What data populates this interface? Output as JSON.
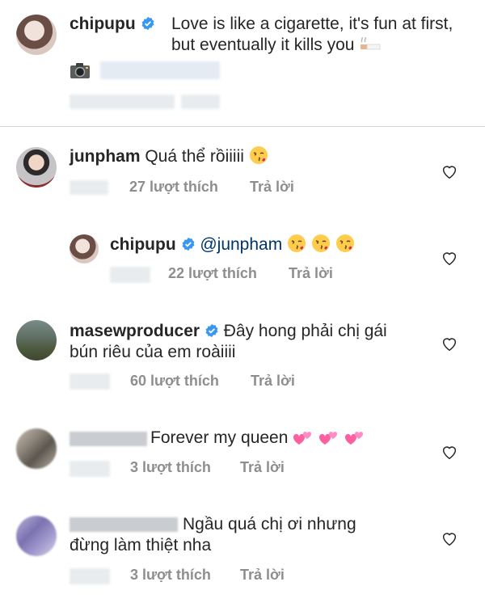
{
  "post": {
    "username": "chipupu",
    "caption": "Love is like a cigarette, it's fun at first, but eventually it kills you"
  },
  "comments": [
    {
      "username": "junpham",
      "text": "Quá thể rồiiiii",
      "likes": "27 lượt thích",
      "reply": "Trả lời"
    },
    {
      "username": "chipupu",
      "mention": "@junpham",
      "likes": "22 lượt thích",
      "reply": "Trả lời"
    },
    {
      "username": "masewproducer",
      "text_line1": "Đây hong phải chị gái",
      "text_line2": "bún riêu của em roàiiii",
      "likes": "60 lượt thích",
      "reply": "Trả lời"
    },
    {
      "text": "Forever my queen",
      "likes": "3 lượt thích",
      "reply": "Trả lời"
    },
    {
      "text_line1": "Ngầu quá chị ơi nhưng",
      "text_line2": "đừng làm thiệt nha",
      "likes": "3 lượt thích",
      "reply": "Trả lời"
    }
  ],
  "icons": {
    "verified": "verified-badge-icon",
    "heart": "heart-outline-icon",
    "cigarette": "cigarette-emoji",
    "camera": "camera-emoji",
    "kiss": "face-blowing-kiss-emoji",
    "hearts": "two-hearts-emoji"
  },
  "colors": {
    "text": "#262626",
    "meta": "#8e8e8e",
    "verified": "#3897f0",
    "mention": "#003569",
    "divider": "#dbdbdb"
  }
}
